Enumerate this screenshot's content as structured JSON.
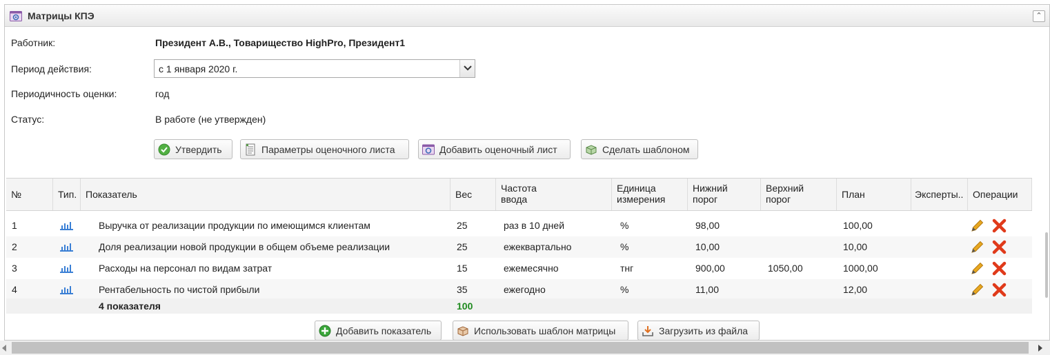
{
  "panel": {
    "title": "Матрицы КПЭ",
    "icon": "kpi-matrix-icon"
  },
  "form": {
    "worker_label": "Работник:",
    "worker_value": "Президент А.В., Товарищество HighPro, Президент1",
    "period_label": "Период действия:",
    "period_value": "с 1 января 2020 г.",
    "frequency_label": "Периодичность оценки:",
    "frequency_value": "год",
    "status_label": "Статус:",
    "status_value": "В работе (не утвержден)"
  },
  "actions": {
    "approve": "Утвердить",
    "sheet_params": "Параметры оценочного листа",
    "add_sheet": "Добавить оценочный лист",
    "make_template": "Сделать шаблоном"
  },
  "table": {
    "headers": {
      "num": "№",
      "type": "Тип.",
      "indicator": "Показатель",
      "weight": "Вес",
      "freq_1": "Частота",
      "freq_2": "ввода",
      "unit_1": "Единица",
      "unit_2": "измерения",
      "lower_1": "Нижний",
      "lower_2": "порог",
      "upper_1": "Верхний",
      "upper_2": "порог",
      "plan": "План",
      "experts": "Эксперты..",
      "ops": "Операции"
    },
    "rows": [
      {
        "num": "1",
        "indicator": "Выручка от реализации продукции по имеющимся клиентам",
        "weight": "25",
        "freq": "раз в 10 дней",
        "unit": "%",
        "lower": "98,00",
        "upper": "",
        "plan": "100,00"
      },
      {
        "num": "2",
        "indicator": "Доля реализации новой продукции в общем объеме реализации",
        "weight": "25",
        "freq": "ежеквартально",
        "unit": "%",
        "lower": "10,00",
        "upper": "",
        "plan": "10,00"
      },
      {
        "num": "3",
        "indicator": "Расходы на персонал по видам затрат",
        "weight": "15",
        "freq": "ежемесячно",
        "unit": "тнг",
        "lower": "900,00",
        "upper": "1050,00",
        "plan": "1000,00"
      },
      {
        "num": "4",
        "indicator": "Рентабельность по чистой прибыли",
        "weight": "35",
        "freq": "ежегодно",
        "unit": "%",
        "lower": "11,00",
        "upper": "",
        "plan": "12,00"
      }
    ],
    "total_label": "4 показателя",
    "total_weight": "100"
  },
  "footer_actions": {
    "add_indicator": "Добавить показатель",
    "use_template": "Использовать шаблон матрицы",
    "load_file": "Загрузить из файла"
  },
  "colors": {
    "total_weight": "#1e8a1e",
    "bar_icon": "#3a7fd5",
    "delete": "#e03a1a",
    "edit": "#e0a020"
  }
}
